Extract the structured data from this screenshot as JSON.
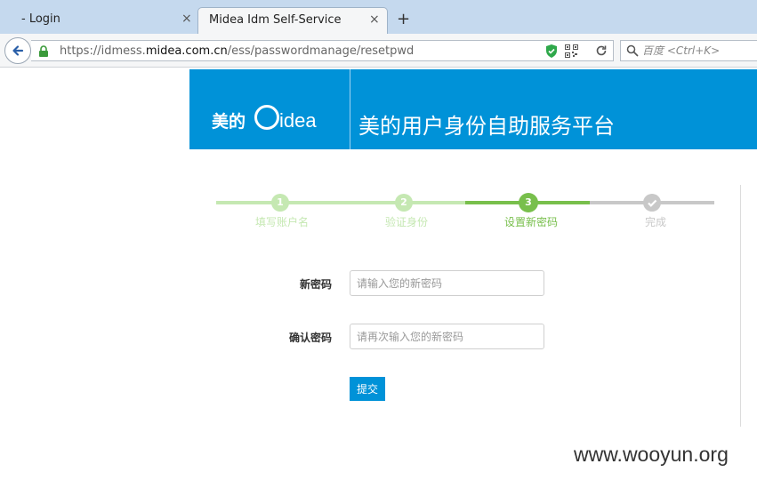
{
  "browser": {
    "tabs": [
      {
        "label": "- Login",
        "close": "×"
      },
      {
        "label": "Midea Idm Self-Service",
        "close": "×"
      }
    ],
    "new_tab": "+",
    "url": {
      "prefix": "https://idmess.",
      "domain": "midea.com.cn",
      "path": "/ess/passwordmanage/resetpwd"
    },
    "search": {
      "placeholder": "百度 <Ctrl+K>"
    }
  },
  "header": {
    "logo_cn": "美的",
    "logo_brand": "idea",
    "title": "美的用户身份自助服务平台",
    "bg_color": "#0092d8"
  },
  "steps": [
    {
      "number": "1",
      "label": "填写账户名",
      "state": "done"
    },
    {
      "number": "2",
      "label": "验证身份",
      "state": "done"
    },
    {
      "number": "3",
      "label": "设置新密码",
      "state": "active"
    },
    {
      "number": "",
      "label": "完成",
      "state": "pending"
    }
  ],
  "colors": {
    "done": "#c5e8b2",
    "active": "#78bf4c",
    "pending": "#c8c8c8"
  },
  "form": {
    "new_password_label": "新密码",
    "new_password_placeholder": "请输入您的新密码",
    "confirm_password_label": "确认密码",
    "confirm_password_placeholder": "请再次输入您的新密码",
    "submit_label": "提交"
  },
  "watermark": "www.wooyun.org"
}
